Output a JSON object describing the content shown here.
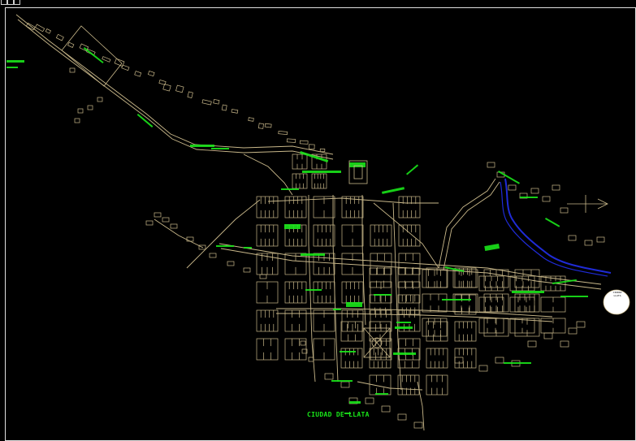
{
  "map": {
    "title": "CIUDAD DE LLATA",
    "colors": {
      "background": "#000000",
      "blocks": "#c9b88a",
      "labels": "#19e619",
      "river": "#1f2bd6",
      "frame": "#e0e0e0"
    },
    "layers": [
      "block-outlines",
      "street-labels",
      "river",
      "plazas"
    ],
    "compass": {
      "symbol": "north-arrow-icon",
      "badge_lines": [
        "CIUDAD",
        "LLATA"
      ]
    }
  }
}
